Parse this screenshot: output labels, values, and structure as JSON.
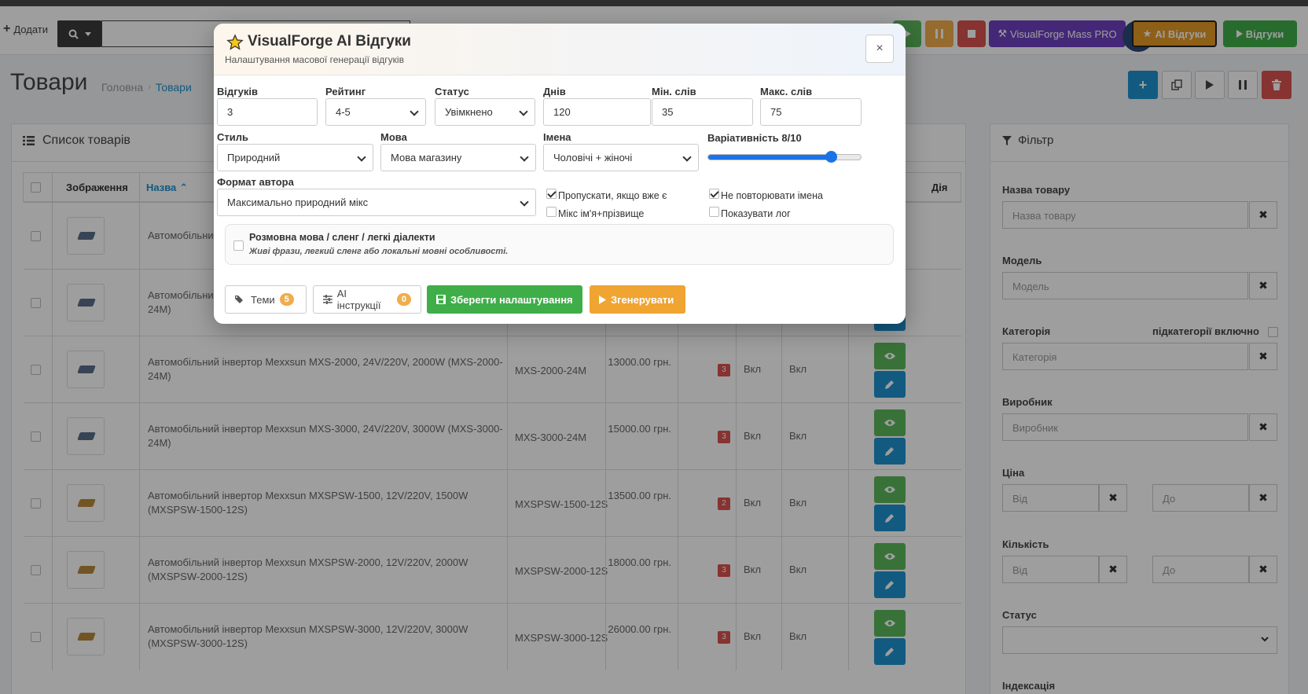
{
  "header": {
    "add_label": "Додати",
    "btn_mass_pro": "VisualForge Mass PRO",
    "btn_ai_reviews": "AI Відгуки",
    "btn_reviews": "Відгуки"
  },
  "page": {
    "title": "Товари",
    "breadcrumb_home": "Головна",
    "breadcrumb_current": "Товари"
  },
  "list": {
    "panel_title": "Список товарів",
    "col_image": "Зображення",
    "col_name": "Назва",
    "col_action": "Дія",
    "rows": [
      {
        "name": "Автомобільний",
        "model": "",
        "price": "",
        "qty": "",
        "s1": "",
        "s2": "",
        "thumb_color": "#5a6f8a"
      },
      {
        "name": "Автомобільний\n24M)",
        "model": "",
        "price": "",
        "qty": "",
        "s1": "",
        "s2": "",
        "thumb_color": "#5a6f8a"
      },
      {
        "name": "Автомобільний інвертор Mexxsun MXS-2000, 24V/220V, 2000W (MXS-2000-24M)",
        "model": "MXS-2000-24M",
        "price": "13000.00 грн.",
        "qty": "3",
        "s1": "Вкл",
        "s2": "Вкл",
        "thumb_color": "#5a6f8a"
      },
      {
        "name": "Автомобільний інвертор Mexxsun MXS-3000, 24V/220V, 3000W (MXS-3000-24M)",
        "model": "MXS-3000-24M",
        "price": "15000.00 грн.",
        "qty": "3",
        "s1": "Вкл",
        "s2": "Вкл",
        "thumb_color": "#5a6f8a"
      },
      {
        "name": "Автомобільний інвертор Mexxsun MXSPSW-1500, 12V/220V, 1500W (MXSPSW-1500-12S)",
        "model": "MXSPSW-1500-12S",
        "price": "13500.00 грн.",
        "qty": "2",
        "s1": "Вкл",
        "s2": "Вкл",
        "thumb_color": "#b8893a"
      },
      {
        "name": "Автомобільний інвертор Mexxsun MXSPSW-2000, 12V/220V, 2000W (MXSPSW-2000-12S)",
        "model": "MXSPSW-2000-12S",
        "price": "18000.00 грн.",
        "qty": "3",
        "s1": "Вкл",
        "s2": "Вкл",
        "thumb_color": "#b8893a"
      },
      {
        "name": "Автомобільний інвертор Mexxsun MXSPSW-3000, 12V/220V, 3000W (MXSPSW-3000-12S)",
        "model": "MXSPSW-3000-12S",
        "price": "26000.00 грн.",
        "qty": "3",
        "s1": "Вкл",
        "s2": "Вкл",
        "thumb_color": "#b8893a"
      }
    ]
  },
  "filter": {
    "title": "Фільтр",
    "name_label": "Назва товару",
    "name_placeholder": "Назва товару",
    "model_label": "Модель",
    "model_placeholder": "Модель",
    "category_label": "Категорія",
    "subcat_label": "підкатегорії включно",
    "category_placeholder": "Категорія",
    "maker_label": "Виробник",
    "maker_placeholder": "Виробник",
    "price_label": "Ціна",
    "from_placeholder": "Від",
    "to_placeholder": "До",
    "qty_label": "Кількість",
    "status_label": "Статус",
    "index_label": "Індексація"
  },
  "modal": {
    "title": "VisualForge AI Відгуки",
    "subtitle": "Налаштування масової генерації відгуків",
    "close": "×",
    "reviews_label": "Відгуків",
    "reviews_value": "3",
    "rating_label": "Рейтинг",
    "rating_value": "4-5",
    "status_label": "Статус",
    "status_value": "Увімкнено",
    "days_label": "Днів",
    "days_value": "120",
    "min_words_label": "Мін. слів",
    "min_words_value": "35",
    "max_words_label": "Макс. слів",
    "max_words_value": "75",
    "style_label": "Стиль",
    "style_value": "Природний",
    "lang_label": "Мова",
    "lang_value": "Мова магазину",
    "names_label": "Імена",
    "names_value": "Чоловічі + жіночі",
    "variability_label": "Варіативність 8/10",
    "variability_level": 0.8,
    "author_format_label": "Формат автора",
    "author_format_value": "Максимально природний мікс",
    "skip_existing": "Пропускати, якщо вже є",
    "no_repeat_names": "Не повторювати імена",
    "mix_name_surname": "Мікс ім'я+прізвище",
    "show_log": "Показувати лог",
    "slang_title": "Розмовна мова / сленг / легкі діалекти",
    "slang_desc": "Живі фрази, легкий сленг або локальні мовні особливості.",
    "themes_btn": "Теми",
    "themes_count": "5",
    "ai_instr_btn": "AI інструкції",
    "ai_instr_count": "0",
    "save_btn": "Зберегти налаштування",
    "generate_btn": "Згенерувати"
  },
  "colors": {
    "accent_blue": "#1e91cf",
    "green": "#5cb85c",
    "orange": "#f0ad4e",
    "red": "#d9534f",
    "purple": "#6f42c1"
  }
}
